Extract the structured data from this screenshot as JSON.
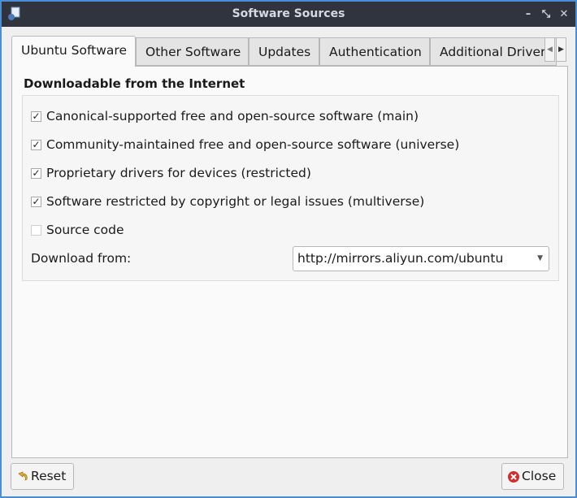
{
  "window": {
    "title": "Software Sources"
  },
  "tabs": [
    {
      "label": "Ubuntu Software"
    },
    {
      "label": "Other Software"
    },
    {
      "label": "Updates"
    },
    {
      "label": "Authentication"
    },
    {
      "label": "Additional Drivers"
    }
  ],
  "section": {
    "heading": "Downloadable from the Internet"
  },
  "options": [
    {
      "label": "Canonical-supported free and open-source software (main)",
      "checked": true
    },
    {
      "label": "Community-maintained free and open-source software (universe)",
      "checked": true
    },
    {
      "label": "Proprietary drivers for devices (restricted)",
      "checked": true
    },
    {
      "label": "Software restricted by copyright or legal issues (multiverse)",
      "checked": true
    },
    {
      "label": "Source code",
      "checked": false
    }
  ],
  "download": {
    "label": "Download from:",
    "value": "http://mirrors.aliyun.com/ubuntu"
  },
  "buttons": {
    "reset": "Reset",
    "close": "Close"
  }
}
